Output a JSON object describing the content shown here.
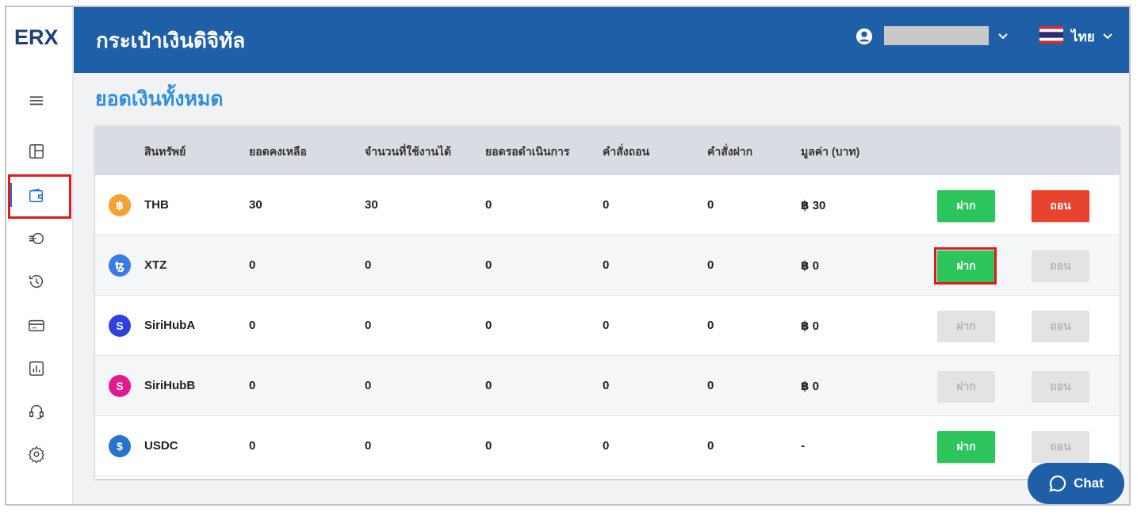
{
  "brand": {
    "logo_text": "ERX"
  },
  "header": {
    "title": "กระเป๋าเงินดิจิทัล",
    "language": "ไทย"
  },
  "section": {
    "title": "ยอดเงินทั้งหมด"
  },
  "table": {
    "columns": [
      "สินทรัพย์",
      "ยอดคงเหลือ",
      "จำนวนที่ใช้งานได้",
      "ยอดรอดำเนินการ",
      "คำสั่งถอน",
      "คำสั่งฝาก",
      "มูลค่า (บาท)"
    ],
    "rows": [
      {
        "asset": "THB",
        "balance": "30",
        "available": "30",
        "pending": "0",
        "withdraw_orders": "0",
        "deposit_orders": "0",
        "value": "฿ 30",
        "deposit_label": "ฝาก",
        "withdraw_label": "ถอน",
        "coin_glyph": "฿",
        "coin_color": "#f7a033",
        "deposit_enabled": true,
        "withdraw_enabled": true
      },
      {
        "asset": "XTZ",
        "balance": "0",
        "available": "0",
        "pending": "0",
        "withdraw_orders": "0",
        "deposit_orders": "0",
        "value": "฿ 0",
        "deposit_label": "ฝาก",
        "withdraw_label": "ถอน",
        "coin_glyph": "ꜩ",
        "coin_color": "#3a7be8",
        "deposit_enabled": true,
        "withdraw_enabled": false
      },
      {
        "asset": "SiriHubA",
        "balance": "0",
        "available": "0",
        "pending": "0",
        "withdraw_orders": "0",
        "deposit_orders": "0",
        "value": "฿ 0",
        "deposit_label": "ฝาก",
        "withdraw_label": "ถอน",
        "coin_glyph": "S",
        "coin_color": "#2f3fe0",
        "deposit_enabled": false,
        "withdraw_enabled": false
      },
      {
        "asset": "SiriHubB",
        "balance": "0",
        "available": "0",
        "pending": "0",
        "withdraw_orders": "0",
        "deposit_orders": "0",
        "value": "฿ 0",
        "deposit_label": "ฝาก",
        "withdraw_label": "ถอน",
        "coin_glyph": "S",
        "coin_color": "#e3198f",
        "deposit_enabled": false,
        "withdraw_enabled": false
      },
      {
        "asset": "USDC",
        "balance": "0",
        "available": "0",
        "pending": "0",
        "withdraw_orders": "0",
        "deposit_orders": "0",
        "value": "-",
        "deposit_label": "ฝาก",
        "withdraw_label": "ถอน",
        "coin_glyph": "$",
        "coin_color": "#2775ca",
        "deposit_enabled": true,
        "withdraw_enabled": false
      }
    ]
  },
  "chat": {
    "label": "Chat"
  },
  "colors": {
    "primary": "#1f5fa8",
    "accent_title": "#2f8ee0",
    "deposit_green": "#2cc55c",
    "withdraw_red": "#e8432f",
    "highlight": "#e01b1b"
  },
  "icons": {
    "sidebar": [
      "menu-icon",
      "dashboard-icon",
      "wallet-icon",
      "transfer-icon",
      "history-icon",
      "card-icon",
      "chart-icon",
      "support-icon",
      "settings-icon"
    ],
    "header": [
      "user-icon",
      "chevron-down-icon",
      "thai-flag-icon"
    ]
  }
}
